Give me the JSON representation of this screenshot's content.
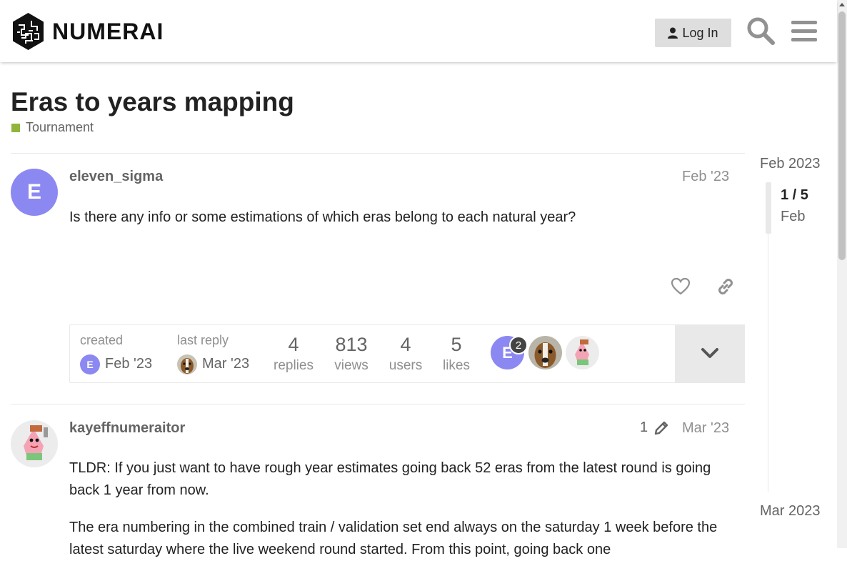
{
  "header": {
    "logo_text": "NUMERAI",
    "login_label": "Log In",
    "search_icon": "search-icon",
    "menu_icon": "hamburger-menu-icon"
  },
  "topic": {
    "title": "Eras to years mapping",
    "category": "Tournament",
    "category_color": "#92b43a"
  },
  "posts": [
    {
      "avatar_letter": "E",
      "avatar_color": "#8c88f2",
      "username": "eleven_sigma",
      "date": "Feb '23",
      "text": "Is there any info or some estimations of which eras belong to each natural year?"
    },
    {
      "username": "kayeffnumeraitor",
      "edit_count": "1",
      "date": "Mar '23",
      "text_1": "TLDR: If you just want to have rough year estimates going back 52 eras from the latest round is going back 1 year from now.",
      "text_2": "The era numbering in the combined train / validation set end always on the saturday 1 week before the latest saturday where the live weekend round started. From this point, going back one"
    }
  ],
  "topic_map": {
    "created_label": "created",
    "created_date": "Feb '23",
    "created_avatar_letter": "E",
    "last_reply_label": "last reply",
    "last_reply_date": "Mar '23",
    "stats": [
      {
        "value": "4",
        "label": "replies"
      },
      {
        "value": "813",
        "label": "views"
      },
      {
        "value": "4",
        "label": "users"
      },
      {
        "value": "5",
        "label": "likes"
      }
    ],
    "participant_letter": "E",
    "participant_post_count": "2"
  },
  "timeline": {
    "start": "Feb 2023",
    "position": "1 / 5",
    "position_date": "Feb",
    "end": "Mar 2023"
  }
}
